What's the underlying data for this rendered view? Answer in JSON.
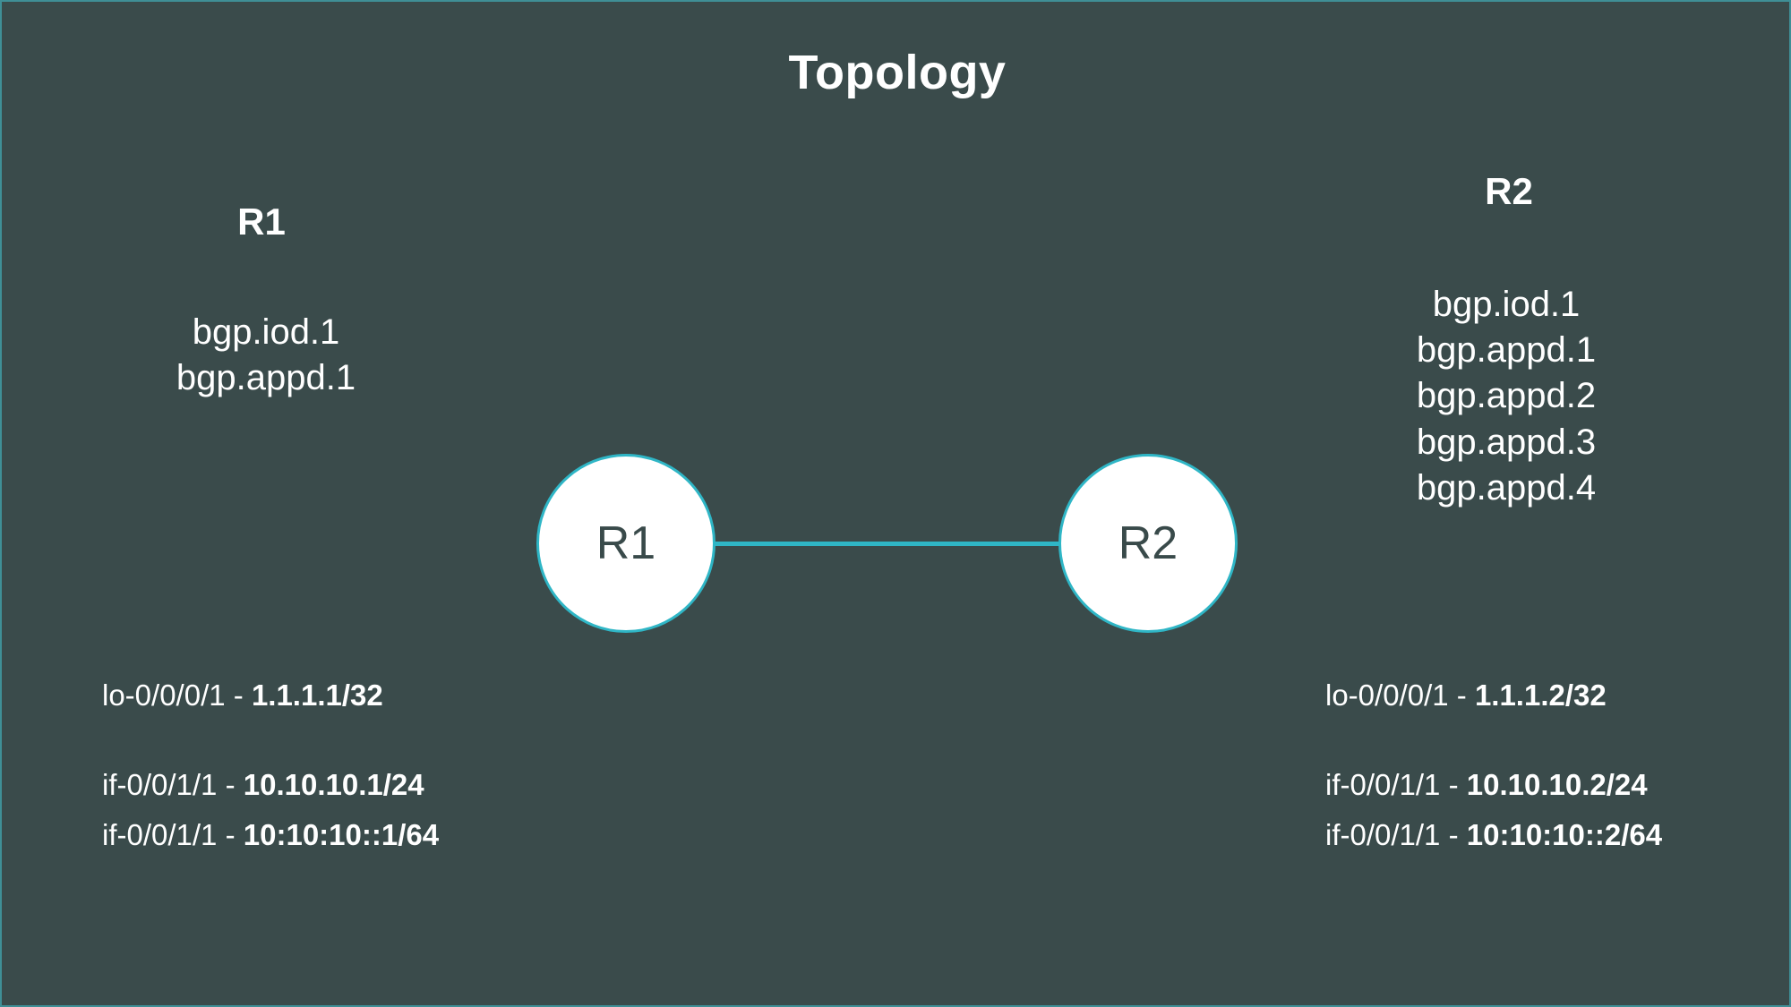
{
  "page": {
    "title": "Topology",
    "background_color": "#3a4b4b",
    "accent_color": "#2fb6c6",
    "text_color": "#ffffff",
    "node_text_color": "#394a4a"
  },
  "routers": {
    "r1": {
      "heading": "R1",
      "node_label": "R1",
      "processes": [
        "bgp.iod.1",
        "bgp.appd.1"
      ],
      "interfaces": [
        {
          "name": "lo-0/0/0/1",
          "separator": "-",
          "address": "1.1.1.1/32"
        },
        {
          "name": "if-0/0/1/1",
          "separator": "-",
          "address": "10.10.10.1/24"
        },
        {
          "name": "if-0/0/1/1",
          "separator": "-",
          "address": "10:10:10::1/64"
        }
      ]
    },
    "r2": {
      "heading": "R2",
      "node_label": "R2",
      "processes": [
        "bgp.iod.1",
        "bgp.appd.1",
        "bgp.appd.2",
        "bgp.appd.3",
        "bgp.appd.4"
      ],
      "interfaces": [
        {
          "name": "lo-0/0/0/1",
          "separator": "-",
          "address": "1.1.1.2/32"
        },
        {
          "name": "if-0/0/1/1",
          "separator": "-",
          "address": "10.10.10.2/24"
        },
        {
          "name": "if-0/0/1/1",
          "separator": "-",
          "address": "10:10:10::2/64"
        }
      ]
    }
  },
  "link": {
    "from": "R1",
    "to": "R2",
    "color": "#2fb6c6"
  }
}
